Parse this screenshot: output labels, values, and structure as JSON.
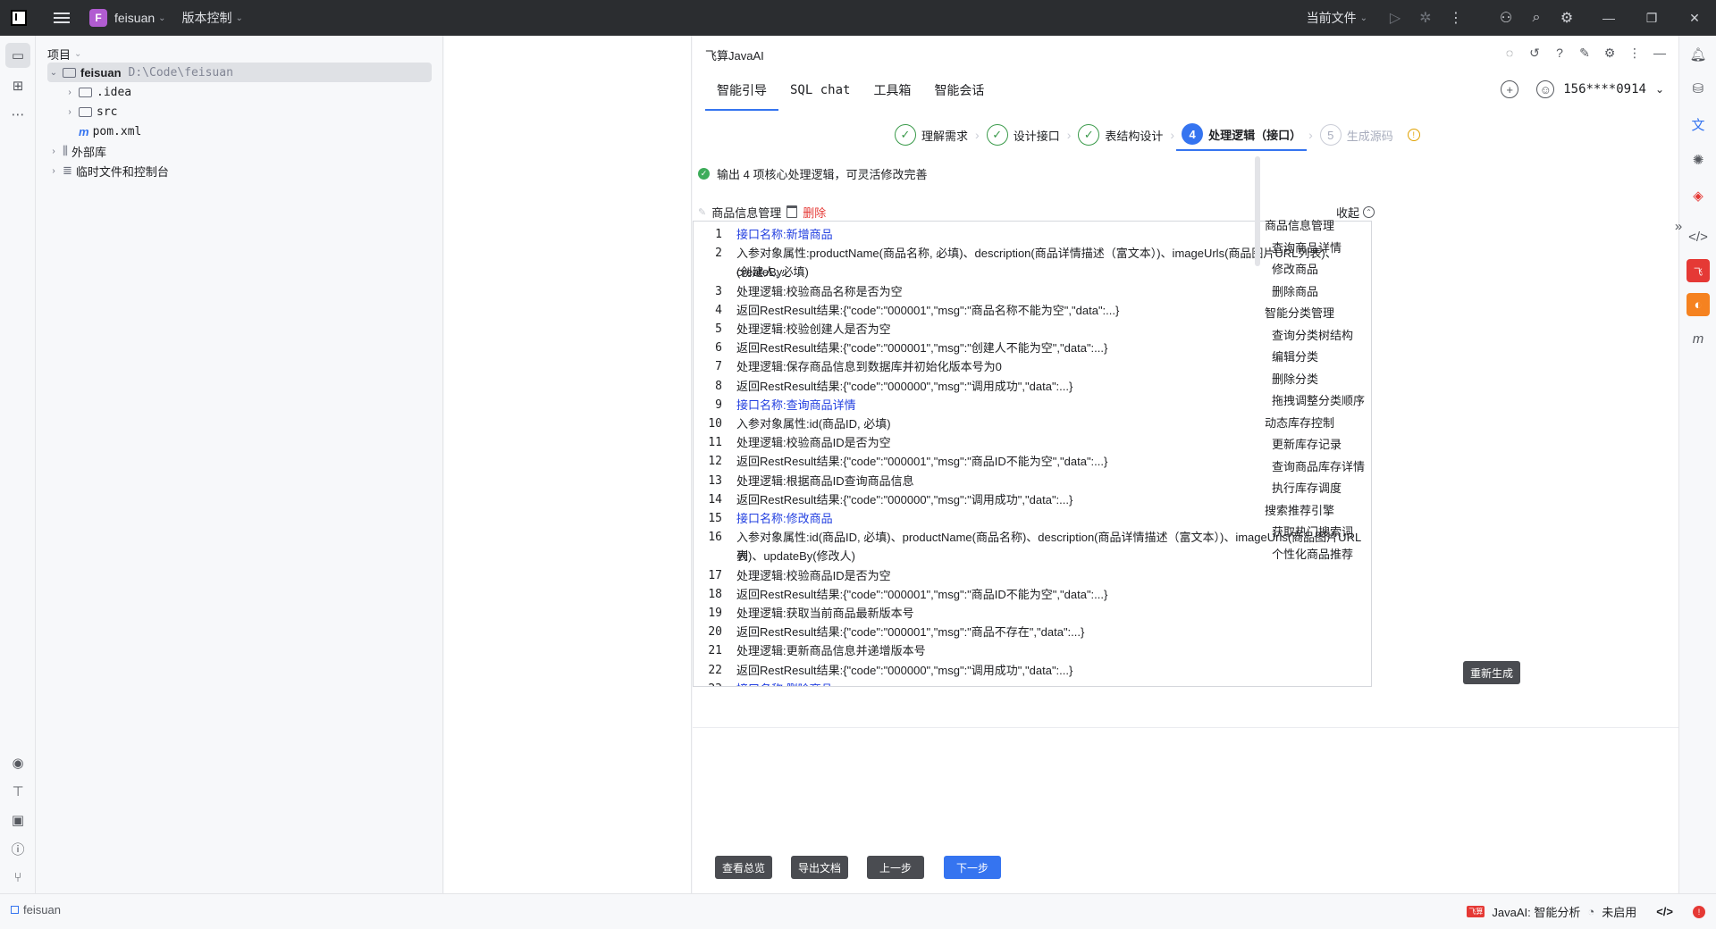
{
  "titlebar": {
    "project_letter": "F",
    "project_name": "feisuan",
    "vcs_label": "版本控制",
    "run_config": "当前文件"
  },
  "project_panel": {
    "header": "项目",
    "tree": [
      {
        "label": "feisuan",
        "hint": "D:\\Code\\feisuan"
      },
      {
        "label": ".idea"
      },
      {
        "label": "src"
      },
      {
        "label": "pom.xml"
      },
      {
        "label": "外部库"
      },
      {
        "label": "临时文件和控制台"
      }
    ]
  },
  "ai_panel": {
    "title": "飞算JavaAI",
    "tabs": [
      "智能引导",
      "SQL chat",
      "工具箱",
      "智能会话"
    ],
    "account": "156****0914",
    "steps": [
      {
        "num": "✓",
        "label": "理解需求"
      },
      {
        "num": "✓",
        "label": "设计接口"
      },
      {
        "num": "✓",
        "label": "表结构设计"
      },
      {
        "num": "4",
        "label": "处理逻辑（接口）"
      },
      {
        "num": "5",
        "label": "生成源码"
      }
    ],
    "status_text": "输出 4 项核心处理逻辑，可灵活修改完善",
    "section_title": "商品信息管理",
    "delete_label": "删除",
    "collapse_label": "收起",
    "code_lines": [
      {
        "n": "1",
        "text": "接口名称:新增商品",
        "iface": true
      },
      {
        "n": "2",
        "text": "入参对象属性:productName(商品名称, 必填)、description(商品详情描述（富文本）)、imageUrls(商品图片URL列表)、createBy",
        "iface": false
      },
      {
        "n": "",
        "text": "(创建人, 必填)",
        "iface": false
      },
      {
        "n": "3",
        "text": "处理逻辑:校验商品名称是否为空",
        "iface": false
      },
      {
        "n": "4",
        "text": "返回RestResult结果:{\"code\":\"000001\",\"msg\":\"商品名称不能为空\",\"data\":...}",
        "iface": false
      },
      {
        "n": "5",
        "text": "处理逻辑:校验创建人是否为空",
        "iface": false
      },
      {
        "n": "6",
        "text": "返回RestResult结果:{\"code\":\"000001\",\"msg\":\"创建人不能为空\",\"data\":...}",
        "iface": false
      },
      {
        "n": "7",
        "text": "处理逻辑:保存商品信息到数据库并初始化版本号为0",
        "iface": false
      },
      {
        "n": "8",
        "text": "返回RestResult结果:{\"code\":\"000000\",\"msg\":\"调用成功\",\"data\":...}",
        "iface": false
      },
      {
        "n": "9",
        "text": "接口名称:查询商品详情",
        "iface": true
      },
      {
        "n": "10",
        "text": "入参对象属性:id(商品ID, 必填)",
        "iface": false
      },
      {
        "n": "11",
        "text": "处理逻辑:校验商品ID是否为空",
        "iface": false
      },
      {
        "n": "12",
        "text": "返回RestResult结果:{\"code\":\"000001\",\"msg\":\"商品ID不能为空\",\"data\":...}",
        "iface": false
      },
      {
        "n": "13",
        "text": "处理逻辑:根据商品ID查询商品信息",
        "iface": false
      },
      {
        "n": "14",
        "text": "返回RestResult结果:{\"code\":\"000000\",\"msg\":\"调用成功\",\"data\":...}",
        "iface": false
      },
      {
        "n": "15",
        "text": "接口名称:修改商品",
        "iface": true
      },
      {
        "n": "16",
        "text": "入参对象属性:id(商品ID, 必填)、productName(商品名称)、description(商品详情描述（富文本）)、imageUrls(商品图片URL列",
        "iface": false
      },
      {
        "n": "",
        "text": "表)、updateBy(修改人)",
        "iface": false
      },
      {
        "n": "17",
        "text": "处理逻辑:校验商品ID是否为空",
        "iface": false
      },
      {
        "n": "18",
        "text": "返回RestResult结果:{\"code\":\"000001\",\"msg\":\"商品ID不能为空\",\"data\":...}",
        "iface": false
      },
      {
        "n": "19",
        "text": "处理逻辑:获取当前商品最新版本号",
        "iface": false
      },
      {
        "n": "20",
        "text": "返回RestResult结果:{\"code\":\"000001\",\"msg\":\"商品不存在\",\"data\":...}",
        "iface": false
      },
      {
        "n": "21",
        "text": "处理逻辑:更新商品信息并递增版本号",
        "iface": false
      },
      {
        "n": "22",
        "text": "返回RestResult结果:{\"code\":\"000000\",\"msg\":\"调用成功\",\"data\":...}",
        "iface": false
      },
      {
        "n": "23",
        "text": "接口名称:删除商品",
        "iface": true
      }
    ],
    "outline": [
      {
        "label": "商品信息管理",
        "level": 0
      },
      {
        "label": "查询商品详情",
        "level": 1
      },
      {
        "label": "修改商品",
        "level": 1
      },
      {
        "label": "删除商品",
        "level": 1
      },
      {
        "label": "智能分类管理",
        "level": 0
      },
      {
        "label": "查询分类树结构",
        "level": 1
      },
      {
        "label": "编辑分类",
        "level": 1
      },
      {
        "label": "删除分类",
        "level": 1
      },
      {
        "label": "拖拽调整分类顺序",
        "level": 1
      },
      {
        "label": "动态库存控制",
        "level": 0
      },
      {
        "label": "更新库存记录",
        "level": 1
      },
      {
        "label": "查询商品库存详情",
        "level": 1
      },
      {
        "label": "执行库存调度",
        "level": 1
      },
      {
        "label": "搜索推荐引擎",
        "level": 0
      },
      {
        "label": "获取热门搜索词",
        "level": 1
      },
      {
        "label": "个性化商品推荐",
        "level": 1
      }
    ],
    "regenerate_label": "重新生成",
    "buttons": {
      "overview": "查看总览",
      "export": "导出文档",
      "prev": "上一步",
      "next": "下一步"
    }
  },
  "statusbar": {
    "project": "feisuan",
    "ai_status": "JavaAI: 智能分析",
    "ai_state": "未启用",
    "badge": "飞算"
  }
}
